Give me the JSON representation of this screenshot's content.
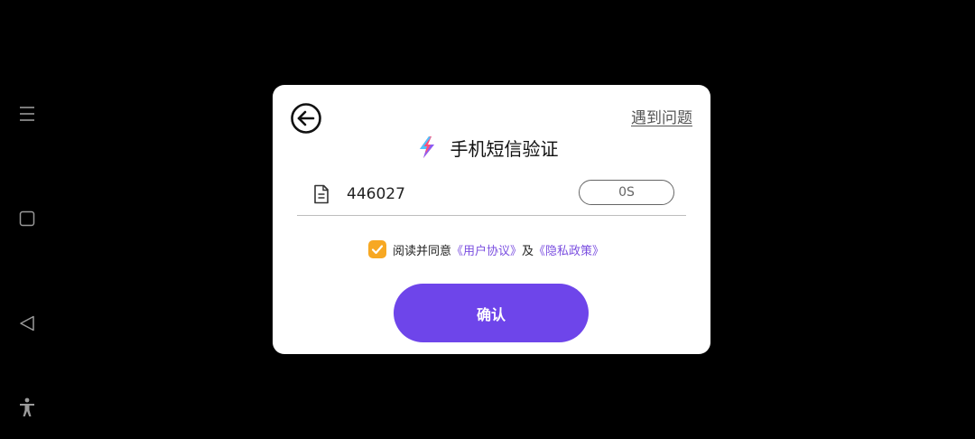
{
  "nav": {
    "menu_icon": "menu-icon",
    "home_icon": "square-home-icon",
    "back_icon": "triangle-back-icon",
    "accessibility_icon": "accessibility-icon"
  },
  "dialog": {
    "back_icon": "arrow-left-circle-icon",
    "help_link": "遇到问题",
    "logo_icon": "lightning-bolt-icon",
    "title": "手机短信验证",
    "code_icon": "document-icon",
    "code_value": "446027",
    "countdown": "0S",
    "agree": {
      "checked": true,
      "prefix": "阅读并同意",
      "user_agreement": "《用户协议》",
      "and": "及",
      "privacy_policy": "《隐私政策》"
    },
    "confirm_button": "确认"
  },
  "colors": {
    "background": "#000000",
    "dialog": "#ffffff",
    "accent": "#6e45ea",
    "link": "#7b4fe0",
    "checkbox": "#f7a823"
  }
}
